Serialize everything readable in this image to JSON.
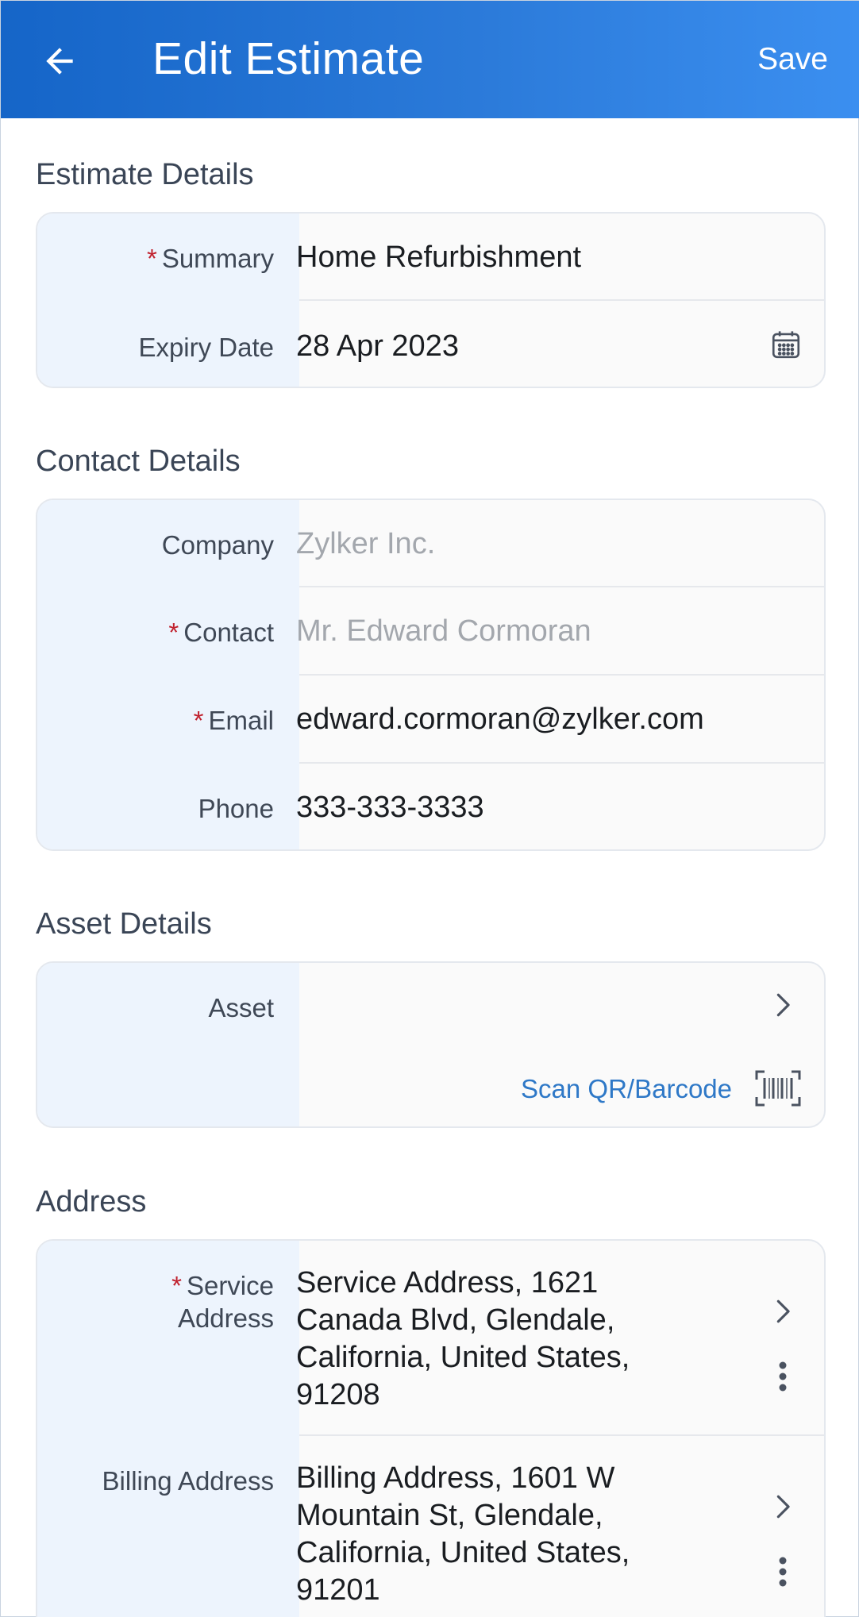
{
  "header": {
    "title": "Edit Estimate",
    "save_label": "Save"
  },
  "sections": {
    "estimate": {
      "title": "Estimate Details",
      "summary_label": "Summary",
      "summary_value": "Home Refurbishment",
      "expiry_label": "Expiry Date",
      "expiry_value": "28 Apr 2023"
    },
    "contact": {
      "title": "Contact Details",
      "company_label": "Company",
      "company_placeholder": "Zylker Inc.",
      "contact_label": "Contact",
      "contact_placeholder": "Mr. Edward Cormoran",
      "email_label": "Email",
      "email_value": "edward.cormoran@zylker.com",
      "phone_label": "Phone",
      "phone_value": "333-333-3333"
    },
    "asset": {
      "title": "Asset Details",
      "asset_label": "Asset",
      "scan_label": "Scan QR/Barcode"
    },
    "address": {
      "title": "Address",
      "service_label_1": "Service",
      "service_label_2": "Address",
      "service_lines": [
        "Service Address, 1621",
        "Canada Blvd, Glendale,",
        "California, United States,",
        "91208"
      ],
      "billing_label": "Billing Address",
      "billing_lines": [
        "Billing Address, 1601 W",
        "Mountain St, Glendale,",
        "California, United States,",
        "91201"
      ]
    }
  },
  "required_marker": "*",
  "icons": {
    "back": "arrow-left-icon",
    "calendar": "calendar-icon",
    "chevron": "chevron-right-icon",
    "barcode": "barcode-scan-icon",
    "more": "more-vertical-icon"
  },
  "colors": {
    "header_start": "#1565c8",
    "header_end": "#3b8ff0",
    "required": "#c0212e",
    "link": "#2e78c7",
    "label_bg": "#edf4fd"
  }
}
